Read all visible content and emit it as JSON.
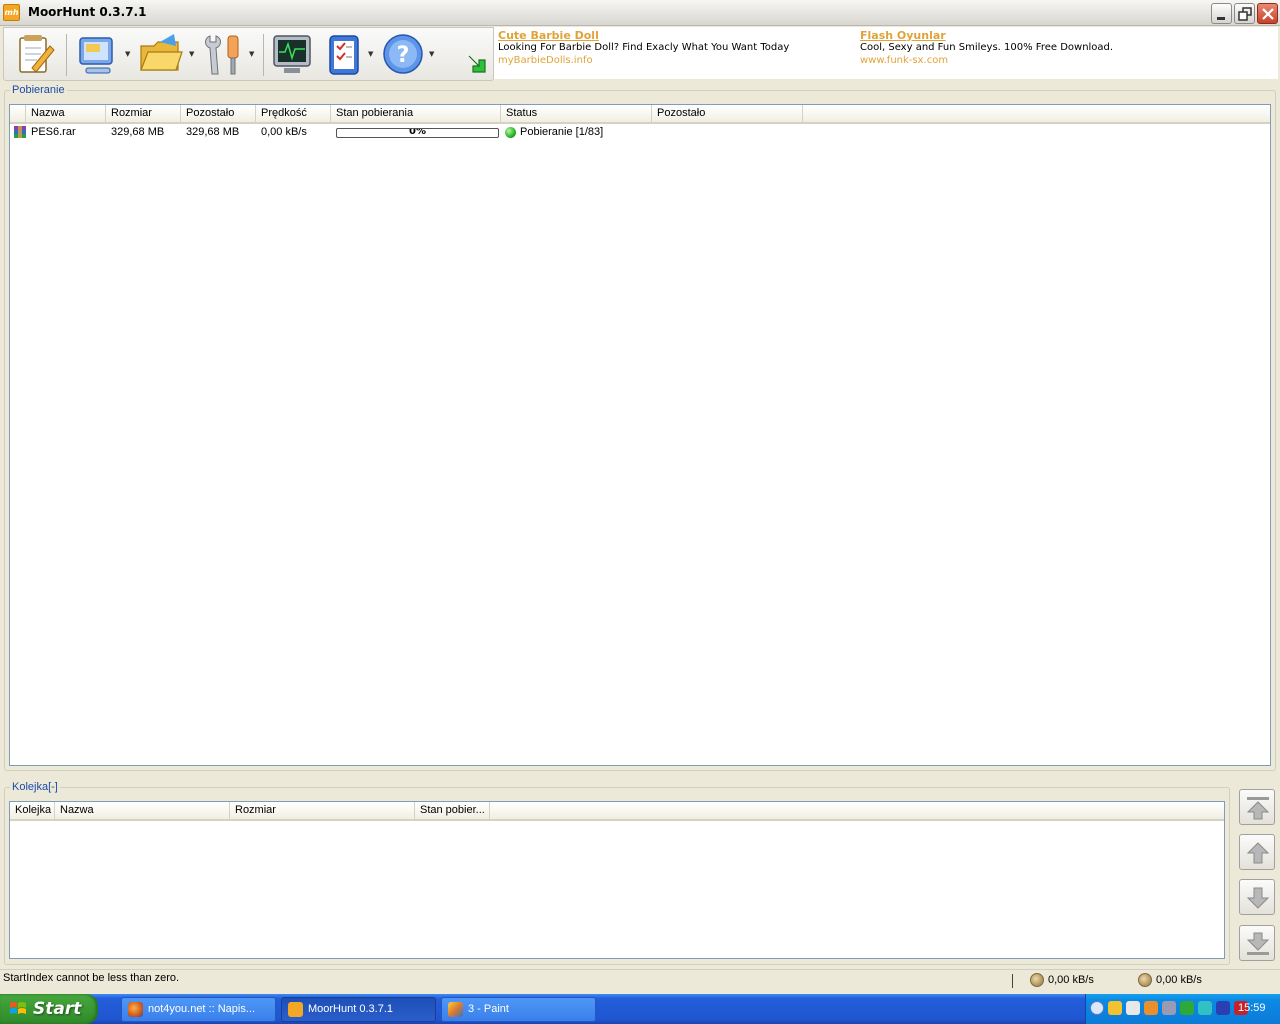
{
  "window": {
    "title": "MoorHunt 0.3.7.1",
    "app_icon": "mh"
  },
  "toolbar": {
    "buttons": [
      "new-download-icon",
      "computer-icon",
      "folder-icon",
      "tools-icon",
      "monitor-icon",
      "checklist-icon",
      "help-icon",
      "green-arrow-icon"
    ]
  },
  "ads": [
    {
      "title": "Cute Barbie Doll",
      "desc": "Looking For Barbie Doll? Find Exacly What You Want Today",
      "url": "myBarbieDolls.info"
    },
    {
      "title": "Flash Oyunlar",
      "desc": "Cool, Sexy and Fun Smileys. 100% Free Download.",
      "url": "www.funk-sx.com"
    }
  ],
  "downloads": {
    "label": "Pobieranie",
    "columns": [
      "Nazwa",
      "Rozmiar",
      "Pozostało",
      "Prędkość",
      "Stan pobierania",
      "Status",
      "Pozostało"
    ],
    "rows": [
      {
        "name": "PES6.rar",
        "size": "329,68 MB",
        "remaining": "329,68 MB",
        "speed": "0,00 kB/s",
        "progress_text": "0%",
        "progress": 0,
        "status": "Pobieranie [1/83]",
        "time_left": ""
      }
    ]
  },
  "queue": {
    "label": "Kolejka[-]",
    "columns": [
      "Kolejka",
      "Nazwa",
      "Rozmiar",
      "Stan  pobier..."
    ]
  },
  "statusbar": {
    "message": "StartIndex cannot be less than zero.",
    "download_speed": "0,00 kB/s",
    "upload_speed": "0,00 kB/s"
  },
  "taskbar": {
    "start": "Start",
    "tasks": [
      {
        "label": "not4you.net :: Napis...",
        "icon": "firefox-icon",
        "active": false
      },
      {
        "label": "MoorHunt 0.3.7.1",
        "icon": "moorhunt-icon",
        "active": true
      },
      {
        "label": "3 - Paint",
        "icon": "paint-icon",
        "active": false
      }
    ],
    "clock": "15:59"
  }
}
